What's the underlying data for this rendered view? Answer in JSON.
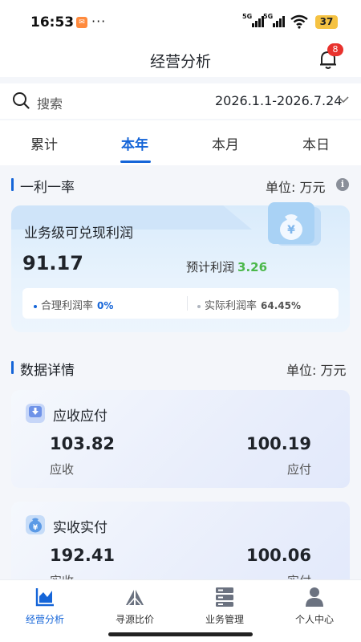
{
  "status_bar": {
    "time": "16:53",
    "more": "···",
    "battery": "37",
    "signal_label": "5G"
  },
  "header": {
    "title": "经营分析",
    "notification_count": "8"
  },
  "search": {
    "placeholder": "搜索",
    "date_range": "2026.1.1-2026.7.24"
  },
  "tabs": [
    {
      "label": "累计",
      "active": false
    },
    {
      "label": "本年",
      "active": true
    },
    {
      "label": "本月",
      "active": false
    },
    {
      "label": "本日",
      "active": false
    }
  ],
  "profit_section": {
    "title": "一利一率",
    "unit": "单位: 万元",
    "card": {
      "label": "业务级可兑现利润",
      "value": "91.17",
      "estimated_label": "预计利润",
      "estimated_value": "3.26",
      "reasonable_rate_label": "合理利润率",
      "reasonable_rate_value": "0%",
      "actual_rate_label": "实际利润率",
      "actual_rate_value": "64.45%"
    }
  },
  "details_section": {
    "title": "数据详情",
    "unit": "单位: 万元",
    "cards": [
      {
        "title": "应收应付",
        "left_value": "103.82",
        "left_label": "应收",
        "right_value": "100.19",
        "right_label": "应付"
      },
      {
        "title": "实收实付",
        "left_value": "192.41",
        "left_label": "实收",
        "right_value": "100.06",
        "right_label": "实付"
      }
    ]
  },
  "bottom_nav": [
    {
      "label": "经营分析",
      "icon": "chart-icon",
      "active": true
    },
    {
      "label": "寻源比价",
      "icon": "triangle-icon",
      "active": false
    },
    {
      "label": "业务管理",
      "icon": "server-icon",
      "active": false
    },
    {
      "label": "个人中心",
      "icon": "user-icon",
      "active": false
    }
  ],
  "colors": {
    "accent": "#1565d8",
    "positive": "#4cb84b",
    "badge": "#e8322d"
  }
}
